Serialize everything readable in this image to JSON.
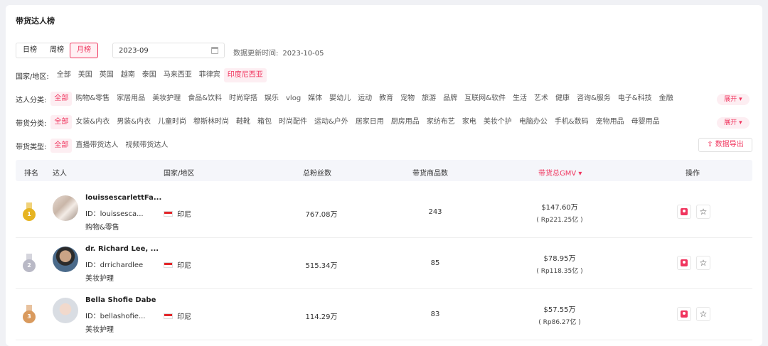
{
  "page_title": "带货达人榜",
  "period_tabs": [
    {
      "label": "日榜",
      "active": false
    },
    {
      "label": "周榜",
      "active": false
    },
    {
      "label": "月榜",
      "active": true
    }
  ],
  "date_value": "2023-09",
  "update_label": "数据更新时间:",
  "update_value": "2023-10-05",
  "filters": {
    "region": {
      "label": "国家/地区:",
      "options": [
        "全部",
        "美国",
        "英国",
        "越南",
        "泰国",
        "马来西亚",
        "菲律宾",
        "印度尼西亚"
      ],
      "active": "印度尼西亚"
    },
    "creator_category": {
      "label": "达人分类:",
      "options": [
        "全部",
        "购物&零售",
        "家居用品",
        "美妆护理",
        "食品&饮料",
        "时尚穿搭",
        "娱乐",
        "vlog",
        "媒体",
        "婴幼儿",
        "运动",
        "教育",
        "宠物",
        "旅游",
        "品牌",
        "互联网&软件",
        "生活",
        "艺术",
        "健康",
        "咨询&服务",
        "电子&科技",
        "金融"
      ],
      "active": "全部",
      "expand_label": "展开"
    },
    "goods_category": {
      "label": "带货分类:",
      "options": [
        "全部",
        "女装&内衣",
        "男装&内衣",
        "儿童时尚",
        "穆斯林时尚",
        "鞋靴",
        "箱包",
        "时尚配件",
        "运动&户外",
        "居家日用",
        "厨房用品",
        "家纺布艺",
        "家电",
        "美妆个护",
        "电脑办公",
        "手机&数码",
        "宠物用品",
        "母婴用品"
      ],
      "active": "全部",
      "expand_label": "展开"
    },
    "sales_type": {
      "label": "带货类型:",
      "options": [
        "全部",
        "直播带货达人",
        "视频带货达人"
      ],
      "active": "全部"
    }
  },
  "export_label": "数据导出",
  "table": {
    "headers": {
      "rank": "排名",
      "creator": "达人",
      "region": "国家/地区",
      "fans": "总粉丝数",
      "goods": "带货商品数",
      "gmv": "带货总GMV",
      "action": "操作"
    },
    "rows": [
      {
        "rank": "1",
        "medal": "gold",
        "name": "louissescarlettFa...",
        "id": "ID：louissesca...",
        "category": "购物&零售",
        "country": "印尼",
        "fans": "767.08万",
        "goods": "243",
        "gmv": "$147.60万",
        "gmv_local": "( Rp221.25亿 )"
      },
      {
        "rank": "2",
        "medal": "silver",
        "name": "dr. Richard Lee, ...",
        "id": "ID：drrichardlee",
        "category": "美妆护理",
        "country": "印尼",
        "fans": "515.34万",
        "goods": "85",
        "gmv": "$78.95万",
        "gmv_local": "( Rp118.35亿 )"
      },
      {
        "rank": "3",
        "medal": "bronze",
        "name": "Bella Shofie Dabe",
        "id": "ID：bellashofie...",
        "category": "美妆护理",
        "country": "印尼",
        "fans": "114.29万",
        "goods": "83",
        "gmv": "$57.55万",
        "gmv_local": "( Rp86.27亿 )"
      }
    ]
  },
  "colors": {
    "accent": "#f0355e",
    "gold": "#e6b422",
    "silver": "#b9b9c6",
    "bronze": "#d99a5e"
  }
}
